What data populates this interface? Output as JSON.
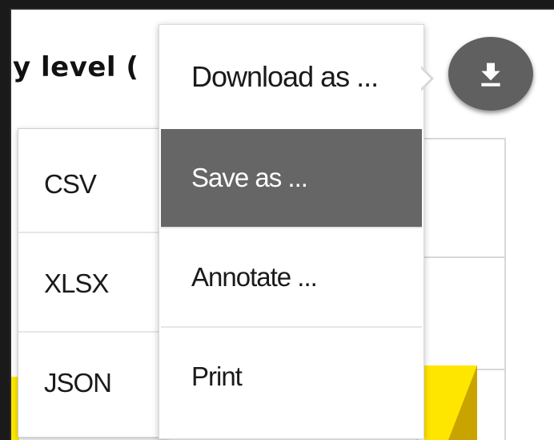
{
  "page": {
    "title_fragment": "y level ("
  },
  "download_button": {
    "icon": "download-icon"
  },
  "menu": {
    "header_label": "Download as ...",
    "items": [
      {
        "label": "Save as ...",
        "active": true
      },
      {
        "label": "Annotate ...",
        "active": false
      },
      {
        "label": "Print",
        "active": false
      }
    ]
  },
  "submenu": {
    "items": [
      {
        "label": "CSV"
      },
      {
        "label": "XLSX"
      },
      {
        "label": "JSON"
      }
    ]
  },
  "colors": {
    "active_item_bg": "#666666",
    "button_bg": "#606060",
    "accent_yellow": "#ffe600"
  }
}
